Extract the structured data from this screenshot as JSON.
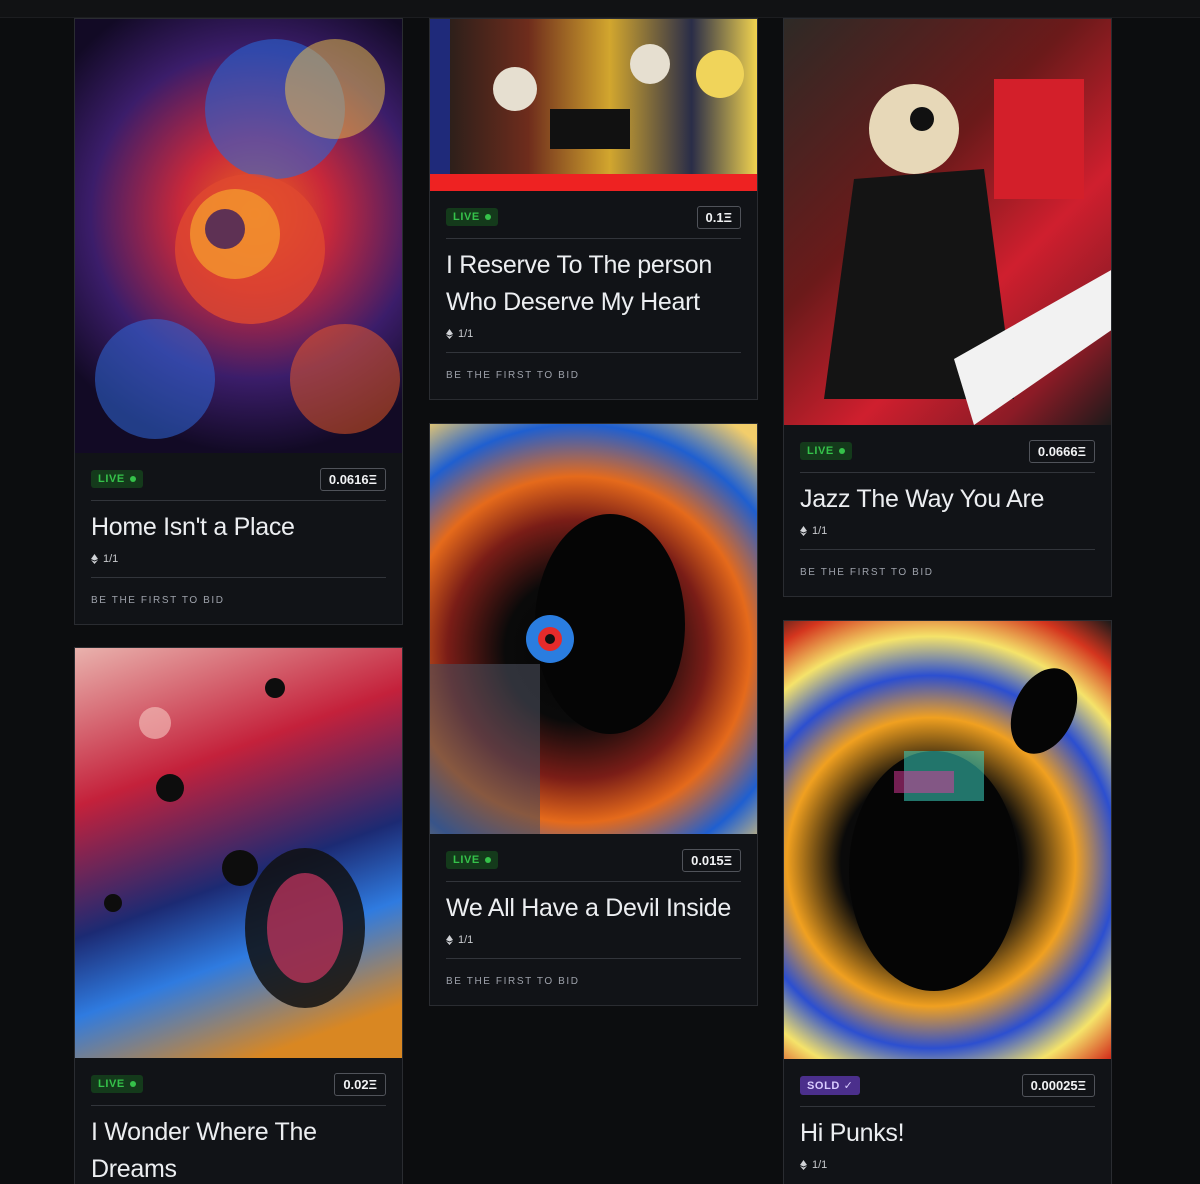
{
  "cards": [
    {
      "status": "LIVE",
      "price": "0.0616Ξ",
      "title": "Home Isn't a Place",
      "edition": "1/1",
      "cta": "BE THE FIRST TO BID"
    },
    {
      "status": "LIVE",
      "price": "0.02Ξ",
      "title": "I Wonder Where The Dreams",
      "edition": "",
      "cta": ""
    },
    {
      "status": "LIVE",
      "price": "0.1Ξ",
      "title": "I Reserve To The person Who Deserve My Heart",
      "edition": "1/1",
      "cta": "BE THE FIRST TO BID"
    },
    {
      "status": "LIVE",
      "price": "0.015Ξ",
      "title": "We All Have a Devil Inside",
      "edition": "1/1",
      "cta": "BE THE FIRST TO BID"
    },
    {
      "status": "LIVE",
      "price": "0.0666Ξ",
      "title": "Jazz The Way You Are",
      "edition": "1/1",
      "cta": "BE THE FIRST TO BID"
    },
    {
      "status": "SOLD ✓",
      "price": "0.00025Ξ",
      "title": "Hi Punks!",
      "edition": "1/1",
      "cta": ""
    }
  ],
  "artwork_icons": [
    "snail-artwork-image",
    "beetle-artwork-image",
    "skeleton-band-artwork-image",
    "devil-silhouette-artwork-image",
    "skeleton-pianist-artwork-image",
    "punk-silhouette-artwork-image"
  ]
}
